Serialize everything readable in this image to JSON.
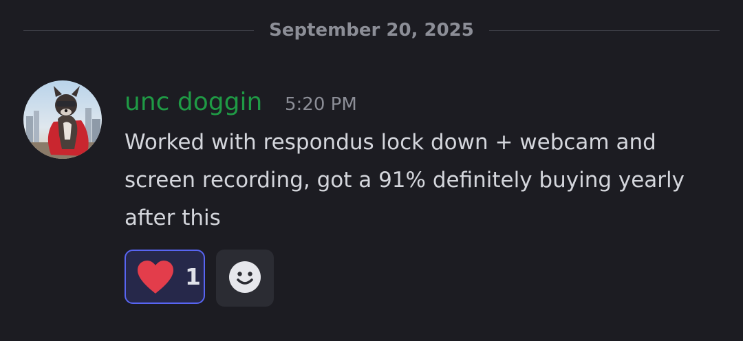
{
  "date_divider": {
    "label": "September 20, 2025"
  },
  "message": {
    "author": "unc doggin",
    "author_color": "#1f9a45",
    "timestamp": "5:20 PM",
    "avatar_icon": "dog-with-cape-avatar",
    "text": "Worked with respondus lock down + webcam and screen recording, got a 91% definitely buying yearly after this"
  },
  "reactions": [
    {
      "emoji_icon": "heart-icon",
      "count": "1",
      "selected": true
    }
  ],
  "add_reaction": {
    "icon": "smiley-face-icon"
  },
  "colors": {
    "background": "#1c1c22",
    "muted_text": "#8c8e97",
    "body_text": "#d4d6dc",
    "reaction_border": "#5865f2",
    "heart": "#e33d4b"
  }
}
